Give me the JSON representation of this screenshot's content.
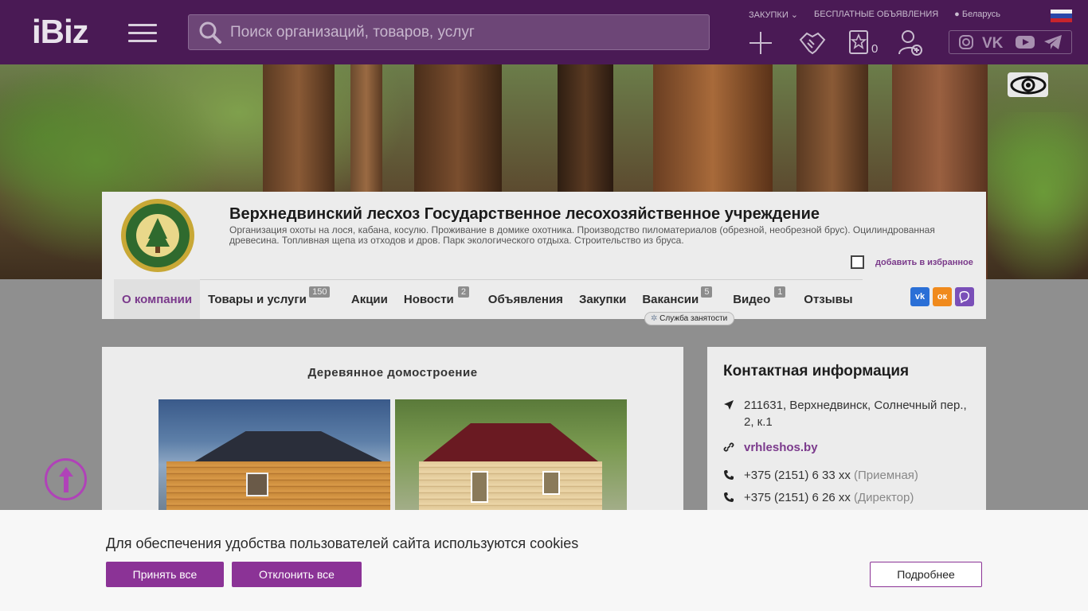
{
  "header": {
    "logo": "iBiz",
    "search_placeholder": "Поиск организаций, товаров, услуг",
    "links": [
      "ЗАКУПКИ",
      "БЕСПЛАТНЫЕ ОБЪЯВЛЕНИЯ"
    ],
    "region": "Беларусь",
    "favorites_count": "0"
  },
  "company": {
    "title": "Верхнедвинский лесхоз Государственное лесохозяйственное учреждение",
    "description": "Организация охоты на лося, кабана, косулю. Проживание в домике охотника. Производство пиломатериалов (обрезной, необрезной брус). Оцилиндрованная древесина. Топливная щепа из отходов и дров. Парк экологического отдыха. Строительство из бруса.",
    "add_favorite": "добавить в избранное"
  },
  "nav": {
    "items": [
      {
        "label": "О компании",
        "badge": ""
      },
      {
        "label": "Товары и услуги",
        "badge": "150"
      },
      {
        "label": "Акции",
        "badge": ""
      },
      {
        "label": "Новости",
        "badge": "2"
      },
      {
        "label": "Объявления",
        "badge": ""
      },
      {
        "label": "Закупки",
        "badge": ""
      },
      {
        "label": "Вакансии",
        "badge": "5"
      },
      {
        "label": "Видео",
        "badge": "1"
      },
      {
        "label": "Отзывы",
        "badge": ""
      }
    ],
    "tooltip": "Служба занятости"
  },
  "main": {
    "section_title": "Деревянное домостроение"
  },
  "contacts": {
    "title": "Контактная информация",
    "address": "211631, Верхнедвинск, Солнечный пер., 2, к.1",
    "website": "vrhleshos.by",
    "phones": [
      {
        "number": "+375 (2151) 6 33 xx",
        "note": "(Приемная)"
      },
      {
        "number": "+375 (2151) 6 26 xx",
        "note": "(Директор)"
      }
    ]
  },
  "cookie": {
    "text": "Для обеспечения удобства пользователей сайта используются cookies",
    "accept": "Принять все",
    "reject": "Отклонить все",
    "more": "Подробнее"
  },
  "colors": {
    "brand": "#4a1a55",
    "accent": "#8b3396"
  }
}
